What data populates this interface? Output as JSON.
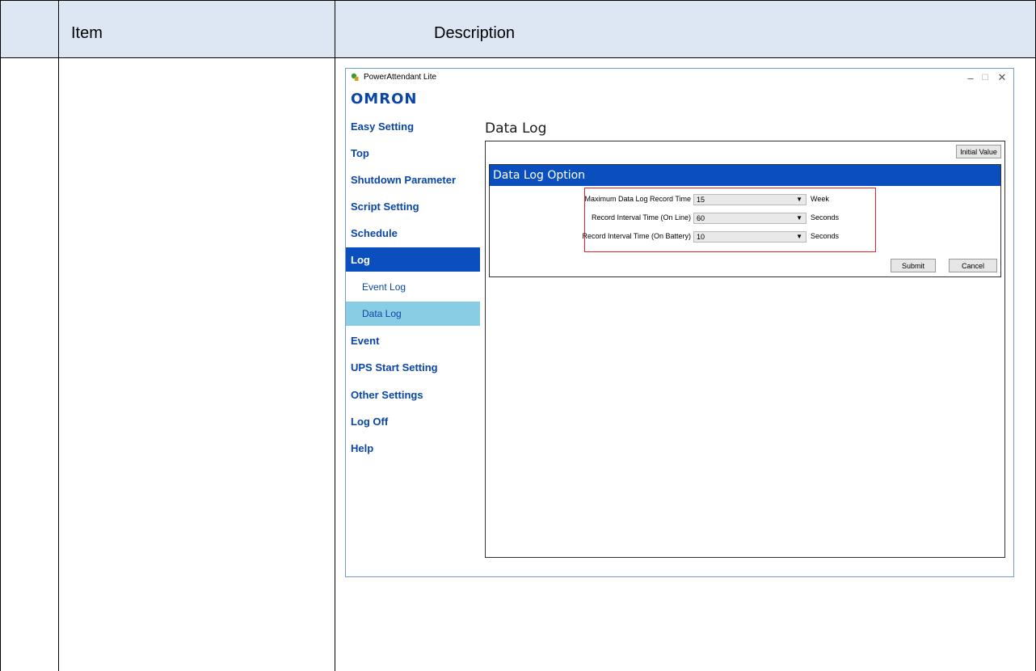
{
  "table": {
    "header_item": "Item",
    "header_description": "Description"
  },
  "window": {
    "title": "PowerAttendant Lite",
    "logo": "OMRON",
    "controls": {
      "minimize": "–",
      "maximize": "☐",
      "close": "✕"
    }
  },
  "sidebar": {
    "items": [
      {
        "label": "Easy Setting"
      },
      {
        "label": "Top"
      },
      {
        "label": "Shutdown Parameter"
      },
      {
        "label": "Script Setting"
      },
      {
        "label": "Schedule"
      },
      {
        "label": "Log"
      },
      {
        "label": "Event Log"
      },
      {
        "label": "Data Log"
      },
      {
        "label": "Event"
      },
      {
        "label": "UPS Start Setting"
      },
      {
        "label": "Other Settings"
      },
      {
        "label": "Log Off"
      },
      {
        "label": "Help"
      }
    ],
    "active_item": "Log",
    "active_subitem": "Data Log"
  },
  "main": {
    "page_title": "Data Log",
    "initial_value_button": "Initial Value",
    "section_title": "Data Log Option",
    "fields": [
      {
        "label": "Maximum Data Log Record Time",
        "value": "15",
        "unit": "Week"
      },
      {
        "label": "Record Interval Time (On Line)",
        "value": "60",
        "unit": "Seconds"
      },
      {
        "label": "Record Interval Time (On Battery)",
        "value": "10",
        "unit": "Seconds"
      }
    ],
    "submit_button": "Submit",
    "cancel_button": "Cancel"
  },
  "colors": {
    "header_bg": "#dde7f3",
    "accent_blue": "#0a4fbd",
    "link_blue": "#0a46a7",
    "subitem_active": "#88cde3",
    "highlight_red": "#e2222a"
  }
}
